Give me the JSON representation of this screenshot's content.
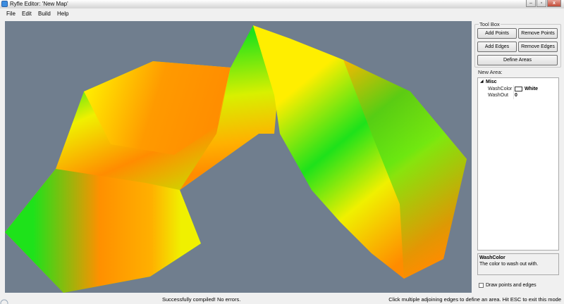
{
  "window": {
    "title": "Ryfle Editor: 'New Map'"
  },
  "menu": [
    "File",
    "Edit",
    "Build",
    "Help"
  ],
  "toolbox": {
    "title": "Tool Box",
    "buttons": {
      "add_points": "Add Points",
      "remove_points": "Remove Points",
      "add_edges": "Add Edges",
      "remove_edges": "Remove Edges",
      "define_areas": "Define Areas"
    },
    "new_area_label": "New Area:",
    "properties": {
      "category": "Misc",
      "toggle": "◢",
      "rows": [
        {
          "name": "WashColor",
          "value": "White",
          "swatch": "#ffffff"
        },
        {
          "name": "WashOut",
          "value": "0"
        }
      ]
    },
    "description": {
      "title": "WashColor",
      "text": "The color to wash out with."
    },
    "draw_points_label": "Draw points and edges"
  },
  "status": {
    "message": "Successfully compiled! No errors.",
    "hint": "Click multiple adjoining edges to define an area. Hit ESC to exit this mode"
  },
  "colors": {
    "viewport_bg": "#707e8e",
    "green": "#1ee21a",
    "yellow": "#f0f000",
    "orange": "#ff8c00"
  }
}
